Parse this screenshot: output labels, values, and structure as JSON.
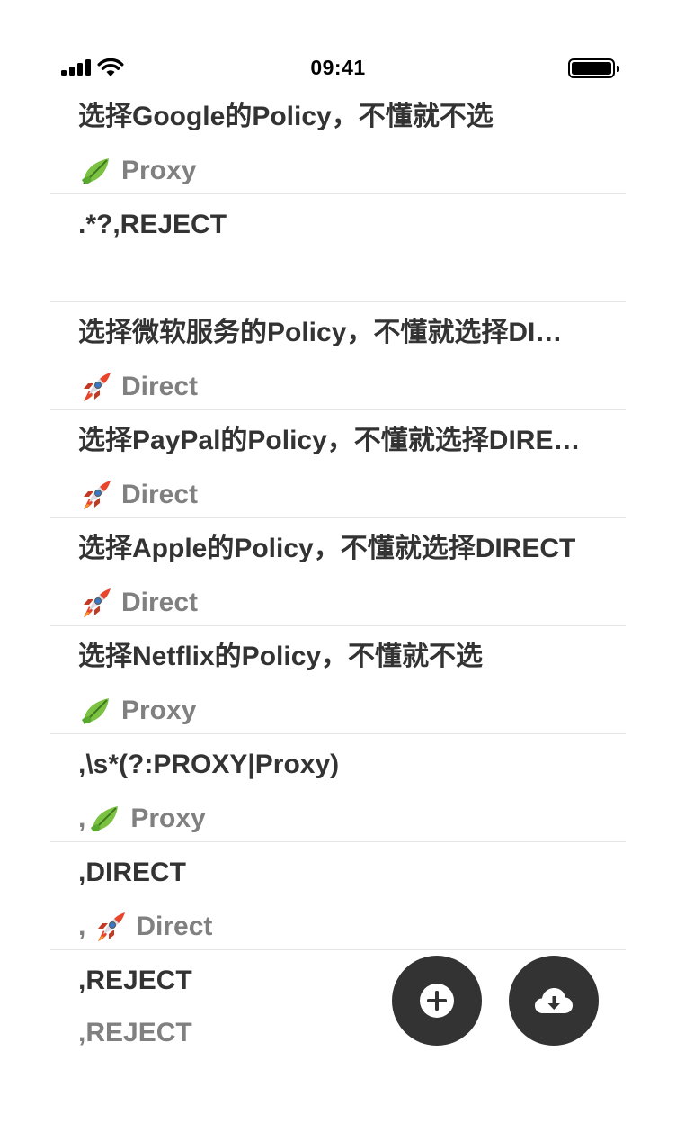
{
  "status_bar": {
    "time": "09:41"
  },
  "rules": [
    {
      "title": "选择Google的Policy，不懂就不选",
      "prefix": "",
      "value": "Proxy",
      "icon": "leaf-icon"
    },
    {
      "title": ".*?,REJECT",
      "prefix": "",
      "value": "",
      "icon": ""
    },
    {
      "title": "选择微软服务的Policy，不懂就选择DI…",
      "prefix": "",
      "value": "Direct",
      "icon": "rocket-icon"
    },
    {
      "title": "选择PayPal的Policy，不懂就选择DIRE…",
      "prefix": "",
      "value": "Direct",
      "icon": "rocket-icon"
    },
    {
      "title": "选择Apple的Policy，不懂就选择DIRECT",
      "prefix": "",
      "value": "Direct",
      "icon": "rocket-icon"
    },
    {
      "title": "选择Netflix的Policy，不懂就不选",
      "prefix": "",
      "value": "Proxy",
      "icon": "leaf-icon"
    },
    {
      "title": ",\\s*(?:PROXY|Proxy)",
      "prefix": ",",
      "value": "Proxy",
      "icon": "leaf-icon"
    },
    {
      "title": ",DIRECT",
      "prefix": ",",
      "value": "Direct",
      "icon": "rocket-icon"
    },
    {
      "title": ",REJECT",
      "prefix": "",
      "value": ",REJECT",
      "icon": ""
    }
  ],
  "fabs": {
    "add": {
      "icon": "plus-circle-icon"
    },
    "download": {
      "icon": "cloud-download-icon"
    }
  },
  "colors": {
    "title_text": "#333333",
    "subtitle_text": "#808080",
    "fab_bg": "#333333",
    "divider": "#e4e4e4"
  }
}
